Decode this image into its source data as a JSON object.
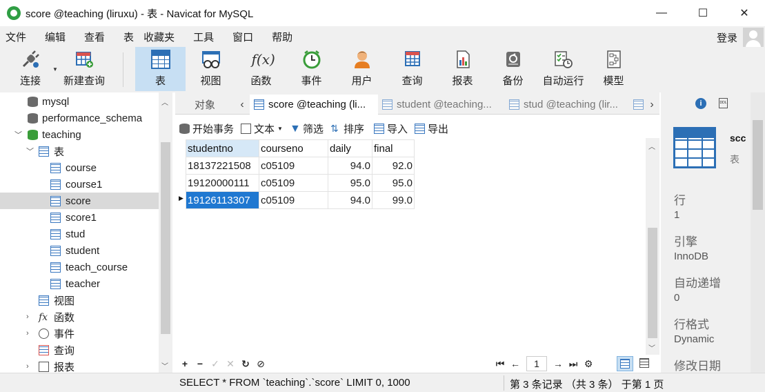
{
  "window": {
    "title": "score @teaching (liruxu) - 表 - Navicat for MySQL",
    "minimize": "—",
    "maximize": "☐",
    "close": "✕"
  },
  "menubar": {
    "items": [
      "文件",
      "编辑",
      "查看",
      "表",
      "收藏夹",
      "工具",
      "窗口",
      "帮助"
    ],
    "login": "登录"
  },
  "toolbar": {
    "connect": "连接",
    "new_query": "新建查询",
    "table": "表",
    "view": "视图",
    "function": "函数",
    "event": "事件",
    "user": "用户",
    "query": "查询",
    "report": "报表",
    "backup": "备份",
    "automation": "自动运行",
    "model": "模型",
    "function_icon_text": "f(x)"
  },
  "sidebar": {
    "items": [
      {
        "label": "mysql",
        "icon": "database-icon"
      },
      {
        "label": "performance_schema",
        "icon": "database-icon"
      },
      {
        "label": "teaching",
        "icon": "database-icon-active"
      },
      {
        "label": "表",
        "icon": "tables-folder-icon"
      },
      {
        "label": "course",
        "icon": "table-icon"
      },
      {
        "label": "course1",
        "icon": "table-icon"
      },
      {
        "label": "score",
        "icon": "table-icon"
      },
      {
        "label": "score1",
        "icon": "table-icon"
      },
      {
        "label": "stud",
        "icon": "table-icon"
      },
      {
        "label": "student",
        "icon": "table-icon"
      },
      {
        "label": "teach_course",
        "icon": "table-icon"
      },
      {
        "label": "teacher",
        "icon": "table-icon"
      },
      {
        "label": "视图",
        "icon": "views-icon"
      },
      {
        "label": "函数",
        "icon": "function-icon"
      },
      {
        "label": "事件",
        "icon": "event-icon"
      },
      {
        "label": "查询",
        "icon": "query-icon"
      },
      {
        "label": "报表",
        "icon": "report-icon"
      }
    ]
  },
  "tabs": {
    "objects": "对象",
    "items": [
      {
        "label": "score @teaching (li...",
        "active": true
      },
      {
        "label": "student @teaching...",
        "active": false
      },
      {
        "label": "stud @teaching (lir...",
        "active": false
      }
    ]
  },
  "subtoolbar": {
    "begin_transaction": "开始事务",
    "text": "文本",
    "filter": "筛选",
    "sort": "排序",
    "import": "导入",
    "export": "导出"
  },
  "grid": {
    "columns": [
      "studentno",
      "courseno",
      "daily",
      "final"
    ],
    "rows": [
      [
        "18137221508",
        "c05109",
        "94.0",
        "92.0"
      ],
      [
        "19120000111",
        "c05109",
        "95.0",
        "95.0"
      ],
      [
        "19126113307",
        "c05109",
        "94.0",
        "99.0"
      ]
    ]
  },
  "footer": {
    "page": "1",
    "add": "+",
    "delete": "−",
    "apply": "✓",
    "discard": "✕",
    "refresh": "↻",
    "stop": "⊘"
  },
  "info_panel": {
    "name": "scc",
    "type": "表",
    "fields": [
      {
        "label": "行",
        "value": "1"
      },
      {
        "label": "引擎",
        "value": "InnoDB"
      },
      {
        "label": "自动递增",
        "value": "0"
      },
      {
        "label": "行格式",
        "value": "Dynamic"
      },
      {
        "label": "修改日期",
        "value": ""
      }
    ]
  },
  "status": {
    "sql": "SELECT * FROM `teaching`.`score` LIMIT 0, 1000",
    "record": "第 3 条记录 （共 3 条） 于第 1 页"
  }
}
